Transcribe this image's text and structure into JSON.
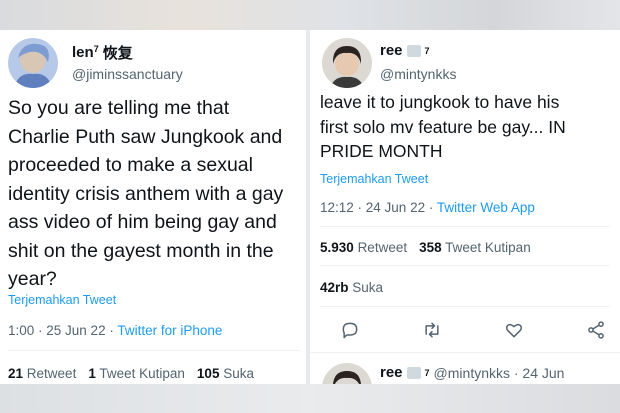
{
  "left_tweet": {
    "display_name": "len",
    "name_sup": "7",
    "name_suffix": "恢复",
    "handle": "@jiminssanctuary",
    "text_lines": [
      "So you are telling me that",
      "Charlie Puth saw Jungkook and",
      "proceeded to make a sexual",
      "identity crisis anthem with a gay",
      "ass video of him being gay and",
      "shit  on the gayest month in the",
      "year?"
    ],
    "translate_label": "Terjemahkan Tweet",
    "timestamp": "1:00 · 25 Jun 22 · ",
    "source_app": "Twitter for iPhone",
    "retweets_count": "21",
    "retweets_label": "Retweet",
    "quotes_count": "1",
    "quotes_label": "Tweet Kutipan",
    "likes_count": "105",
    "likes_label": "Suka"
  },
  "right_tweet": {
    "display_name": "ree",
    "name_sup": "7",
    "handle": "@mintynkks",
    "text_lines": [
      "leave it to jungkook to have his",
      "first solo mv feature be gay... IN",
      "PRIDE MONTH"
    ],
    "translate_label": "Terjemahkan Tweet",
    "timestamp": "12:12 · 24 Jun 22 · ",
    "source_app": "Twitter Web App",
    "retweets_count": "5.930",
    "retweets_label": "Retweet",
    "quotes_count": "358",
    "quotes_label": "Tweet Kutipan",
    "likes_count": "42rb",
    "likes_label": "Suka",
    "icons": [
      "reply-icon",
      "retweet-icon",
      "like-icon",
      "share-icon"
    ]
  },
  "reply_preview": {
    "display_name": "ree",
    "name_sup": "7",
    "handle_time": "@mintynkks · 24 Jun"
  },
  "colors": {
    "link_blue": "#1d9bf0",
    "muted": "#536471",
    "text": "#0f1419"
  }
}
